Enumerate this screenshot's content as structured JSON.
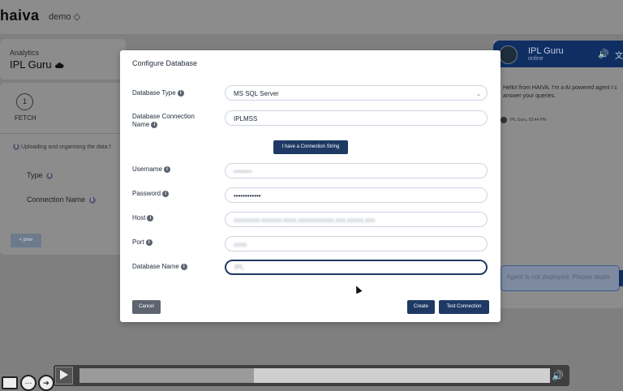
{
  "app": {
    "logo": "haiva",
    "org": "demo ◇"
  },
  "breadcrumb": {
    "section": "Analytics",
    "title": "IPL Guru",
    "title_icon": "cloud-icon"
  },
  "stepper": {
    "step_number": "1",
    "step_label": "FETCH"
  },
  "background_form": {
    "info_text": "Uploading and organising the data f",
    "type_label": "Type",
    "connection_name_label": "Connection Name",
    "prev_button": "< prev"
  },
  "chat": {
    "title": "IPL Guru",
    "status": "online",
    "message": "Hello! from HAIVA. I'm a AI powered agent I c answer your queries.",
    "sender_meta": "IPL Guru, 03:44 PM",
    "input_placeholder": "Agent is not deployed. Please deplo",
    "header_color": "#0f2f63"
  },
  "modal": {
    "title": "Configure Database",
    "fields": {
      "db_type": {
        "label": "Database Type",
        "value": "MS SQL Server"
      },
      "conn_name": {
        "label_line1": "Database Connection",
        "label_line2": "Name",
        "value": "IPLMSS"
      },
      "username": {
        "label": "Username",
        "value": "••••••••"
      },
      "password": {
        "label": "Password",
        "value": "••••••••••••"
      },
      "host": {
        "label": "Host",
        "value": "xxxxxxxx-xxxxxx-xxxx.xxxxxxxxxxx.xxx.xxxxx.xxx"
      },
      "port": {
        "label": "Port",
        "value": "xxxx"
      },
      "db_name": {
        "label": "Database Name",
        "value": "IPL"
      }
    },
    "conn_string_button": "I have a Connection String",
    "cancel_button": "Cancel",
    "create_button": "Create",
    "test_button": "Test Connection",
    "accent_color": "#1e3a64"
  },
  "player": {
    "progress": 0.37
  }
}
